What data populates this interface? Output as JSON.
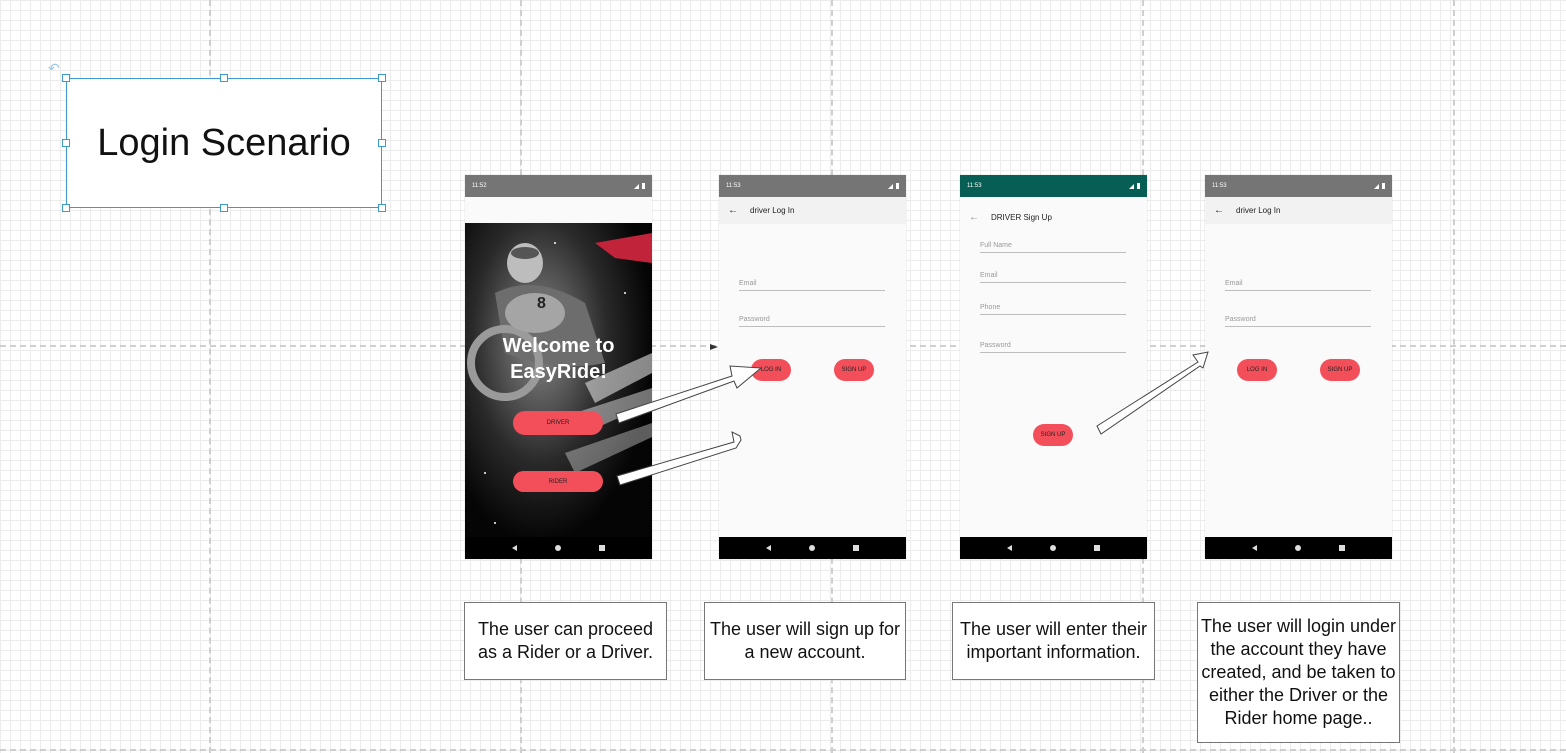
{
  "title": "Login Scenario",
  "screens": {
    "welcome": {
      "time": "11:52",
      "heading_line1": "Welcome to",
      "heading_line2": "EasyRide!",
      "driver_button": "DRIVER",
      "rider_button": "RIDER"
    },
    "driver_login_1": {
      "time": "11:53",
      "toolbar_title": "driver Log In",
      "email_placeholder": "Email",
      "password_placeholder": "Password",
      "login_button": "LOG IN",
      "signup_button": "SIGN UP"
    },
    "driver_signup": {
      "time": "11:53",
      "toolbar_title": "DRIVER Sign Up",
      "full_name_placeholder": "Full Name",
      "email_placeholder": "Email",
      "phone_placeholder": "Phone",
      "password_placeholder": "Password",
      "signup_button": "SIGN UP"
    },
    "driver_login_2": {
      "time": "11:53",
      "toolbar_title": "driver Log In",
      "email_placeholder": "Email",
      "password_placeholder": "Password",
      "login_button": "LOG IN",
      "signup_button": "SIGN UP"
    }
  },
  "captions": [
    "The user can proceed as a Rider or a Driver.",
    "The user will sign up for a new account.",
    "The user will enter their important information.",
    "The user will login under the account they have created, and be taken to either the Driver or the Rider home page.."
  ],
  "colors": {
    "accent_button": "#f34f5b",
    "status_bar_gray": "#757575",
    "status_bar_green": "#075e54",
    "selection_blue": "#3c9ad0"
  },
  "icons": [
    "back-arrow-icon",
    "signal-icon",
    "battery-icon",
    "nav-back-icon",
    "nav-home-icon",
    "nav-recents-icon",
    "rotate-handle-icon"
  ]
}
